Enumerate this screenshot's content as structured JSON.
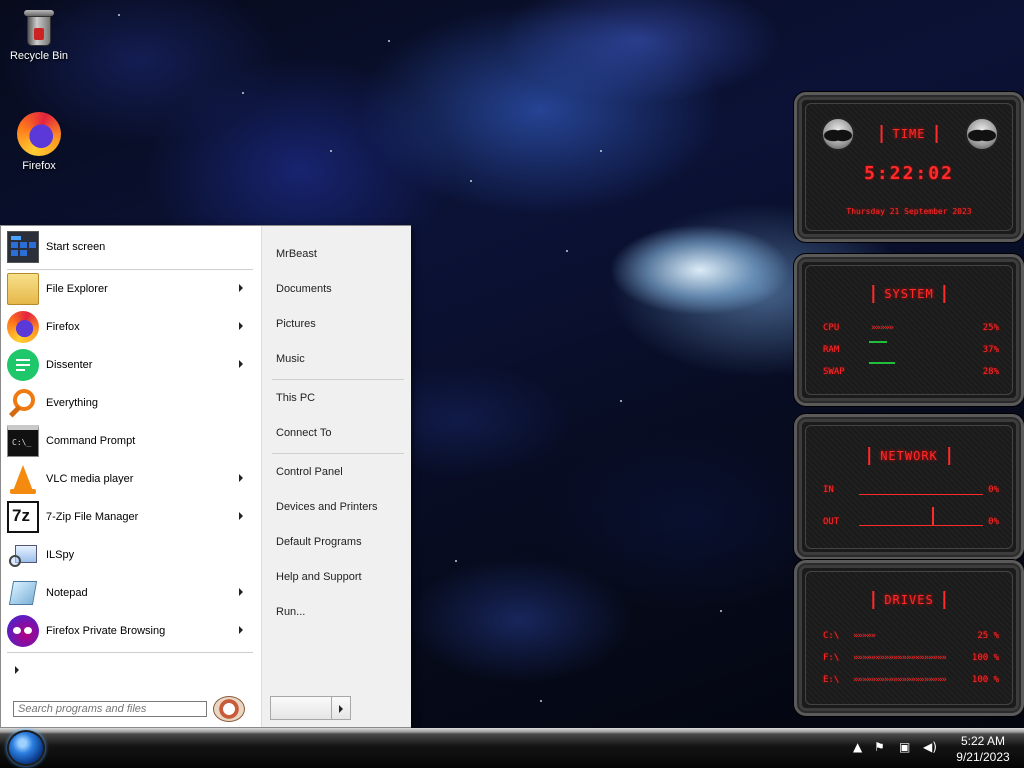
{
  "desktop": {
    "icons": [
      {
        "label": "Recycle Bin",
        "icon": "recycle-bin-icon"
      },
      {
        "label": "Firefox",
        "icon": "firefox-icon"
      }
    ]
  },
  "start_menu": {
    "pinned": {
      "label": "Start screen",
      "icon": "start-screen-icon"
    },
    "programs": [
      {
        "label": "File Explorer",
        "icon": "folder-icon",
        "submenu": true
      },
      {
        "label": "Firefox",
        "icon": "firefox-icon",
        "submenu": true
      },
      {
        "label": "Dissenter",
        "icon": "dissenter-icon",
        "submenu": true
      },
      {
        "label": "Everything",
        "icon": "magnifier-icon",
        "submenu": false
      },
      {
        "label": "Command Prompt",
        "icon": "terminal-icon",
        "submenu": false
      },
      {
        "label": "VLC media player",
        "icon": "vlc-cone-icon",
        "submenu": true
      },
      {
        "label": "7-Zip File Manager",
        "icon": "7zip-icon",
        "submenu": true
      },
      {
        "label": "ILSpy",
        "icon": "ilspy-icon",
        "submenu": false
      },
      {
        "label": "Notepad",
        "icon": "notepad-icon",
        "submenu": true
      },
      {
        "label": "Firefox Private Browsing",
        "icon": "private-browsing-icon",
        "submenu": true
      }
    ],
    "search_placeholder": "Search programs and files",
    "right_links_group1": [
      "MrBeast",
      "Documents",
      "Pictures",
      "Music"
    ],
    "right_links_group2": [
      "This PC",
      "Connect To"
    ],
    "right_links_group3": [
      "Control Panel",
      "Devices and Printers",
      "Default Programs",
      "Help and Support",
      "Run..."
    ]
  },
  "taskbar": {
    "time": "5:22 AM",
    "date": "9/21/2023",
    "tray_icons": [
      "show-hidden-icons-arrow",
      "action-center-flag-icon",
      "network-icon",
      "volume-icon"
    ]
  },
  "gadgets": {
    "time": {
      "title": "TIME",
      "clock": "5:22:02",
      "date": "Thursday 21 September 2023"
    },
    "system": {
      "title": "SYSTEM",
      "rows": [
        {
          "label": "CPU",
          "value": "25%",
          "bar": "»»»»»"
        },
        {
          "label": "RAM",
          "value": "37%",
          "bar": ""
        },
        {
          "label": "SWAP",
          "value": "28%",
          "bar": ""
        }
      ]
    },
    "network": {
      "title": "NETWORK",
      "rows": [
        {
          "label": "IN",
          "value": "0%"
        },
        {
          "label": "OUT",
          "value": "0%"
        }
      ]
    },
    "drives": {
      "title": "DRIVES",
      "rows": [
        {
          "label": "C:\\",
          "value": "25 %",
          "bar": "»»»»»"
        },
        {
          "label": "F:\\",
          "value": "100 %",
          "bar": "»»»»»»»»»»»»»»»»»»»»»"
        },
        {
          "label": "E:\\",
          "value": "100 %",
          "bar": "»»»»»»»»»»»»»»»»»»»»»"
        }
      ]
    }
  }
}
